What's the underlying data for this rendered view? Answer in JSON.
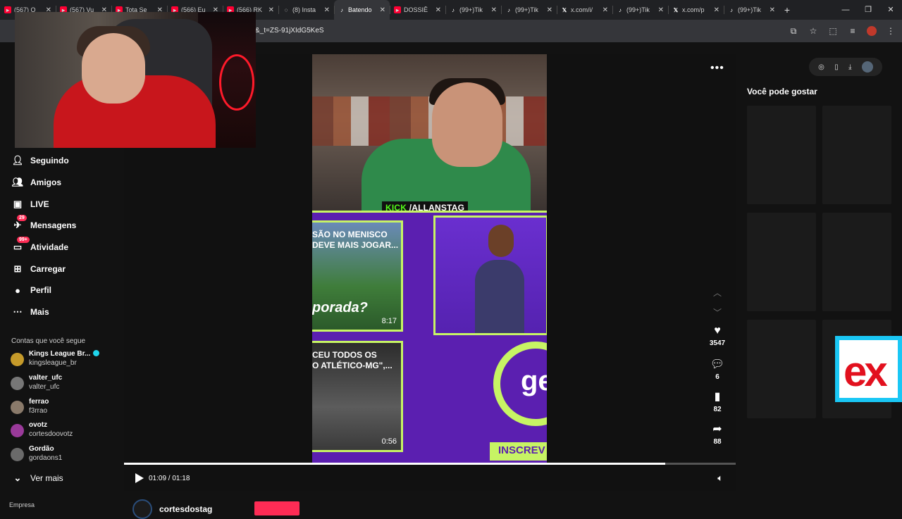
{
  "browser": {
    "tabs": [
      {
        "icon": "youtube",
        "label": "(567) O"
      },
      {
        "icon": "youtube",
        "label": "(567) Vu"
      },
      {
        "icon": "youtube",
        "label": "Tota Se"
      },
      {
        "icon": "youtube",
        "label": "(566) Eu"
      },
      {
        "icon": "youtube",
        "label": "(566) RK"
      },
      {
        "icon": "instagram",
        "label": "(8) Insta"
      },
      {
        "icon": "tiktok",
        "label": "Batendo",
        "active": true
      },
      {
        "icon": "youtube",
        "label": "DOSSIÊ"
      },
      {
        "icon": "tiktok",
        "label": "(99+)Tik"
      },
      {
        "icon": "tiktok",
        "label": "(99+)Tik"
      },
      {
        "icon": "x",
        "label": "x.com/i/"
      },
      {
        "icon": "tiktok",
        "label": "(99+)Tik"
      },
      {
        "icon": "x",
        "label": "x.com/p"
      },
      {
        "icon": "tiktok",
        "label": "(99+)Tik"
      }
    ],
    "url": "&_t=ZS-91jXIdG5KeS"
  },
  "sidebar": {
    "items": [
      {
        "label": "Seguindo",
        "icon": "following-icon"
      },
      {
        "label": "Amigos",
        "icon": "friends-icon"
      },
      {
        "label": "LIVE",
        "icon": "live-icon"
      },
      {
        "label": "Mensagens",
        "icon": "messages-icon",
        "badge": "29"
      },
      {
        "label": "Atividade",
        "icon": "activity-icon",
        "badge": "99+"
      },
      {
        "label": "Carregar",
        "icon": "upload-icon"
      },
      {
        "label": "Perfil",
        "icon": "profile-icon"
      },
      {
        "label": "Mais",
        "icon": "more-icon"
      }
    ],
    "following_title": "Contas que você segue",
    "accounts": [
      {
        "name": "Kings League Br...",
        "handle": "kingsleague_br",
        "verified": true,
        "color": "#c59a2a"
      },
      {
        "name": "valter_ufc",
        "handle": "valter_ufc",
        "color": "#777777"
      },
      {
        "name": "ferrao",
        "handle": "f3rrao",
        "color": "#8a7a6a"
      },
      {
        "name": "ovotz",
        "handle": "cortesdoovotz",
        "color": "#9a3a9a"
      },
      {
        "name": "Gordão",
        "handle": "gordaons1",
        "color": "#6a6a6a"
      }
    ],
    "see_more": "Ver mais",
    "bottom_label": "Empresa"
  },
  "video": {
    "kick_prefix": "KICK",
    "kick_channel": "/ALLANSTAG",
    "thumb1_text": "SÃO NO MENISCO\nDEVE MAIS JOGAR...",
    "thumb1_big": "porada?",
    "thumb1_duration": "8:17",
    "thumb2_text": "CEU TODOS OS\nO ATLÉTICO-MG\",...",
    "thumb2_duration": "0:56",
    "goal_text": "ge",
    "inscreva_text": "INSCREV",
    "time_current": "01:09",
    "time_total": "01:18",
    "progress": 0.885
  },
  "actions": {
    "likes": "3547",
    "comments": "6",
    "saves": "82",
    "shares": "88"
  },
  "right_panel": {
    "title": "Você pode gostar"
  },
  "author": {
    "name": "cortesdostag"
  },
  "colors": {
    "accent": "#fe2c55",
    "kick_green": "#53fc18",
    "lime": "#c7f464",
    "purple": "#5b1fb0"
  }
}
